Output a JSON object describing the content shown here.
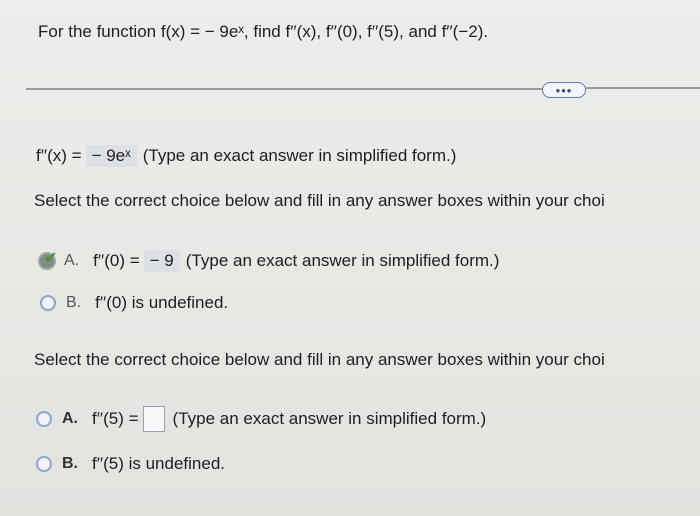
{
  "question": "For the function f(x) = − 9eˣ, find f′′(x), f′′(0), f′′(5), and f′′(−2).",
  "more_button": "•••",
  "part1": {
    "label": "f′′(x) =",
    "answer": "− 9eˣ",
    "instruction": "(Type an exact answer in simplified form.)"
  },
  "section1": {
    "prompt": "Select the correct choice below and fill in any answer boxes within your choi",
    "choice_a": {
      "letter": "A.",
      "label": "f′′(0) =",
      "answer": "− 9",
      "instruction": "(Type an exact answer in simplified form.)",
      "selected": true
    },
    "choice_b": {
      "letter": "B.",
      "label": "f′′(0) is undefined.",
      "selected": false
    }
  },
  "section2": {
    "prompt": "Select the correct choice below and fill in any answer boxes within your choi",
    "choice_a": {
      "letter": "A.",
      "label": "f′′(5) =",
      "instruction": "(Type an exact answer in simplified form.)",
      "selected": false
    },
    "choice_b": {
      "letter": "B.",
      "label": "f′′(5) is undefined.",
      "selected": false
    }
  },
  "colors": {
    "answer_box_bg": "#dde1e6",
    "radio_border": "#8aa5cf",
    "check_green": "#4e8a35",
    "more_button_border": "#5a7bb4"
  }
}
